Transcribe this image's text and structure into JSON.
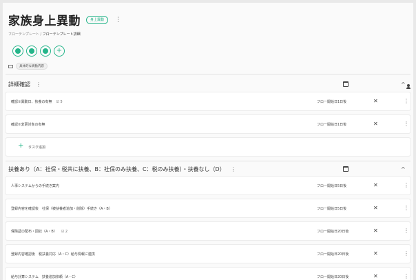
{
  "header": {
    "title": "家族身上異動",
    "badge": "身上異動",
    "kebab": "⋮"
  },
  "breadcrumb": {
    "parent": "フローテンプレート",
    "separator": "/",
    "current": "フローテンプレート詳細"
  },
  "actions": [
    "person-add-icon",
    "document-icon",
    "card-icon",
    "plus-icon"
  ],
  "filter": {
    "chip": "具体的な異動内容"
  },
  "sections": [
    {
      "title": "詳細確認",
      "kebab": "⋮",
      "tasks": [
        {
          "label": "確認①異動日、扶養の有無",
          "sub": "☑ 5",
          "timing": "フロー開始日1日後"
        },
        {
          "label": "確認②変更対象の有無",
          "sub": "",
          "timing": "フロー開始日1日後"
        }
      ],
      "add_label": "タスク追加"
    },
    {
      "title": "扶養あり（A：社保・税共に扶養、B：社保のみ扶養、C：税のみ扶養）・扶養なし（D）",
      "kebab": "⋮",
      "tasks": [
        {
          "label": "人事システムからの手続き案内",
          "sub": "",
          "timing": "フロー開始日5日後"
        },
        {
          "label": "登録内容を確認後　社保（被扶養者追加・削除）手続き（A・B）",
          "sub": "",
          "timing": "フロー開始日5日後"
        },
        {
          "label": "保険証の配布・回収（A・B）",
          "sub": "☑ 2",
          "timing": "フロー開始日20日後"
        },
        {
          "label": "登録内容確認後　税扶養対応（A・C）給与情報に連携",
          "sub": "",
          "timing": "フロー開始日20日後"
        },
        {
          "label": "給与計算システム　扶養追加依頼（A・C）",
          "sub": "",
          "timing": "フロー開始日20日後"
        }
      ]
    }
  ],
  "icons": {
    "calendar": "calendar-icon",
    "assignee": "person-icon",
    "collapse": "^",
    "no_assignee": "✕",
    "row_kebab": "⋮"
  },
  "colors": {
    "accent": "#26b58a"
  }
}
